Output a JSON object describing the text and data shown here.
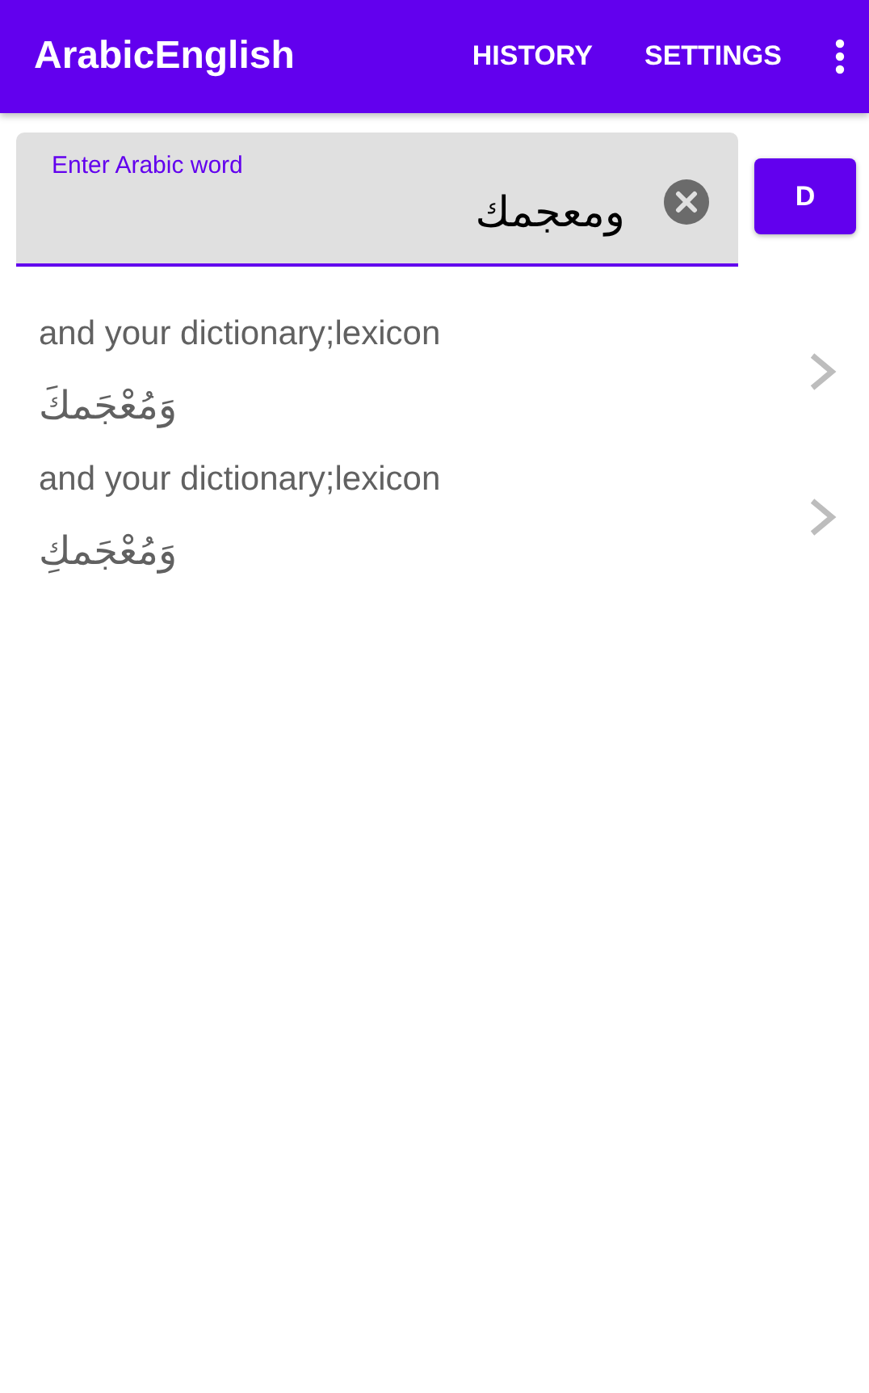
{
  "app_bar": {
    "title": "ArabicEnglish",
    "history": "HISTORY",
    "settings": "SETTINGS"
  },
  "search": {
    "label": "Enter Arabic word",
    "value": "ومعجمك"
  },
  "search_button": "D",
  "results": [
    {
      "english": "and your dictionary;lexicon",
      "arabic": "وَمُعْجَمكَ"
    },
    {
      "english": "and your dictionary;lexicon",
      "arabic": "وَمُعْجَمكِ"
    }
  ]
}
